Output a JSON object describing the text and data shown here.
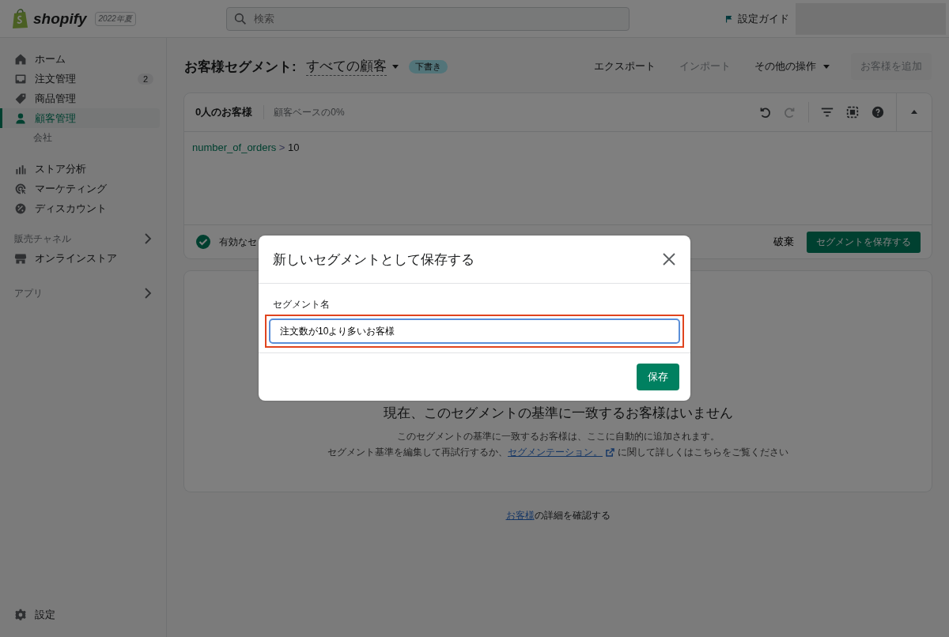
{
  "topbar": {
    "logo_text": "shopify",
    "edition_badge": "2022年夏",
    "search": {
      "placeholder": "検索"
    },
    "setup_guide": "設定ガイド"
  },
  "sidebar": {
    "item_groups": [
      [
        {
          "label": "ホーム",
          "selected": false
        },
        {
          "label": "注文管理",
          "selected": false,
          "badge": "2"
        },
        {
          "label": "商品管理",
          "selected": false
        },
        {
          "label": "顧客管理",
          "selected": true,
          "children": [
            {
              "label": "会社",
              "selected": false
            }
          ]
        }
      ],
      [
        {
          "label": "ストア分析",
          "selected": false
        },
        {
          "label": "マーケティング",
          "selected": false
        },
        {
          "label": "ディスカウント",
          "selected": false
        }
      ]
    ],
    "sections": [
      {
        "title": "販売チャネル",
        "items": [
          {
            "label": "オンラインストア",
            "selected": false
          }
        ]
      },
      {
        "title": "アプリ"
      }
    ],
    "settings": {
      "label": "設定"
    }
  },
  "page": {
    "title": "お客様セグメント:",
    "segment_selector": "すべての顧客",
    "status_badge": "下書き",
    "actions": [
      {
        "label": "エクスポート",
        "disabled": false,
        "kind": "plain"
      },
      {
        "label": "インポート",
        "disabled": true,
        "kind": "plain"
      },
      {
        "label": "その他の操作",
        "disabled": false,
        "kind": "menu"
      }
    ],
    "primary_action": {
      "label": "お客様を追加",
      "disabled": true
    }
  },
  "editor": {
    "count": "0人のお客様",
    "share": "顧客ベースの0%",
    "tools": [
      {
        "disabled": false
      },
      {
        "disabled": true
      },
      {
        "disabled": false
      },
      {
        "disabled": false
      },
      {
        "disabled": false
      }
    ],
    "query": {
      "field": "number_of_orders",
      "operator": ">",
      "value": "10"
    },
    "status": "有効なセ",
    "discard": "破棄",
    "save": "セグメントを保存する"
  },
  "results": {
    "heading": "現在、このセグメントの基準に一致するお客様はいません",
    "line1": "このセグメントの基準に一致するお客様は、ここに自動的に追加されます。",
    "line2_before": "セグメント基準を編集して再試行するか、",
    "line2_link": "セグメンテーション。",
    "line2_after": "に関して詳しくはこちらをご覧ください"
  },
  "footer": {
    "link": "お客様",
    "text": "の詳細を確認する"
  },
  "modal": {
    "title": "新しいセグメントとして保存する",
    "field_label": "セグメント名",
    "field_value": "注文数が10より多いお客様",
    "highlighted": true,
    "save": "保存"
  }
}
